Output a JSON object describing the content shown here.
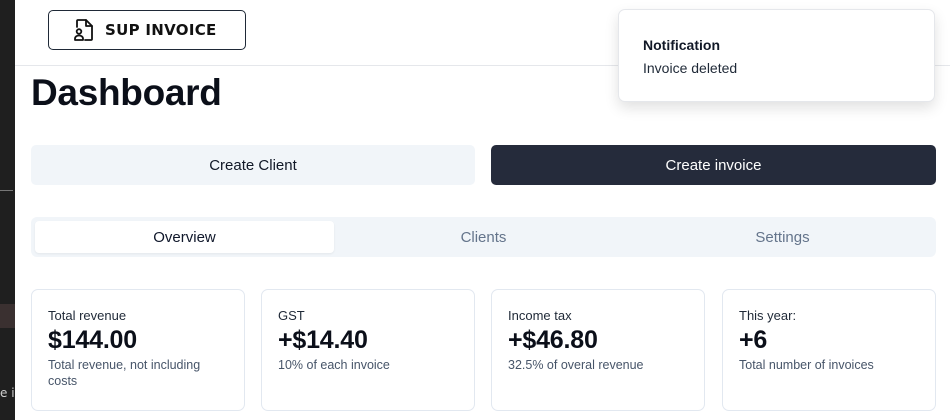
{
  "header": {
    "logo_text": "SUP INVOICE",
    "logo_icon": "document-user-icon"
  },
  "page": {
    "title": "Dashboard"
  },
  "actions": {
    "create_client": "Create Client",
    "create_invoice": "Create invoice"
  },
  "tabs": [
    {
      "label": "Overview",
      "active": true
    },
    {
      "label": "Clients",
      "active": false
    },
    {
      "label": "Settings",
      "active": false
    }
  ],
  "cards": [
    {
      "label": "Total revenue",
      "value": "$144.00",
      "desc": "Total revenue, not including costs"
    },
    {
      "label": "GST",
      "value": "+$14.40",
      "desc": "10% of each invoice"
    },
    {
      "label": "Income tax",
      "value": "+$46.80",
      "desc": "32.5% of overal revenue"
    },
    {
      "label": "This year:",
      "value": "+6",
      "desc": "Total number of invoices"
    }
  ],
  "notification": {
    "title": "Notification",
    "message": "Invoice deleted"
  },
  "background_window": {
    "snippet": "e i"
  },
  "colors": {
    "primary_button": "#252b3b",
    "secondary_button": "#f1f5f9",
    "tabs_bg": "#f1f5f9",
    "border": "#e2e8f0"
  }
}
